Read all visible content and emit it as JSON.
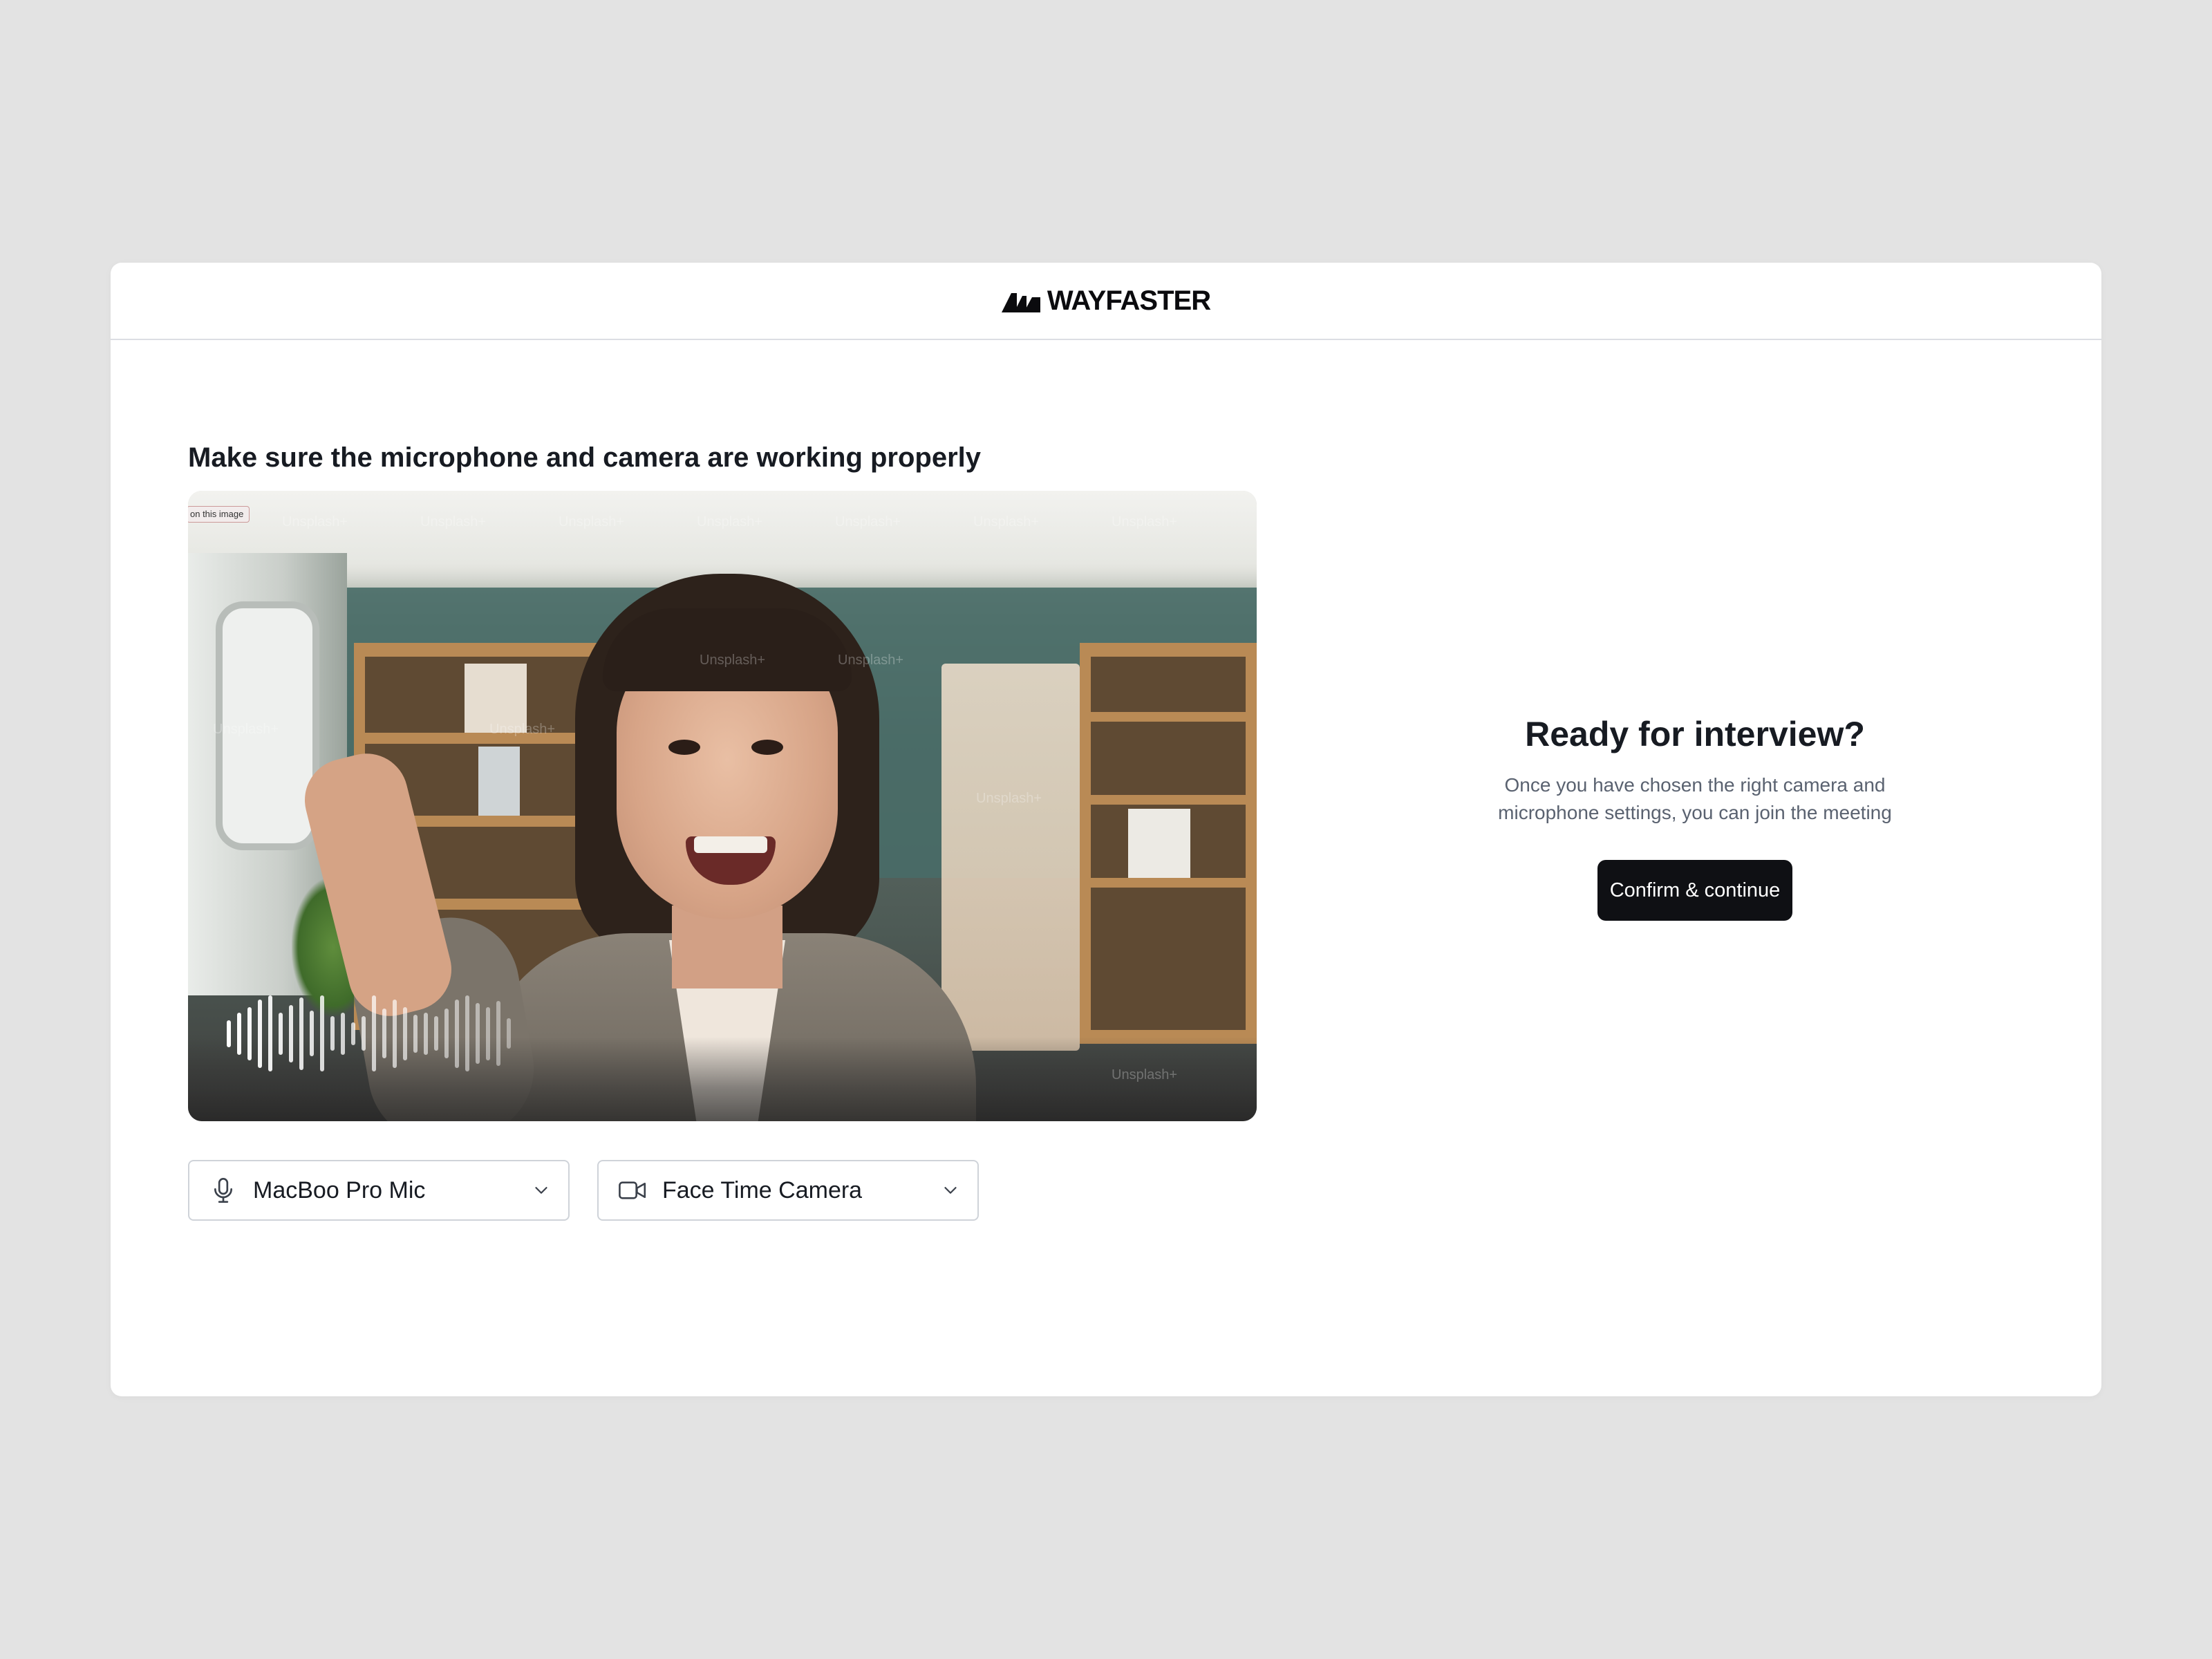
{
  "header": {
    "brand_name": "WAYFASTER",
    "logo_icon": "wayfaster-logo-icon"
  },
  "device_check": {
    "heading": "Make sure the microphone and camera are working properly",
    "video_preview": {
      "photo_tag": "on this image",
      "watermark": "Unsplash+",
      "audio_levels": [
        0.35,
        0.55,
        0.7,
        0.9,
        1.0,
        0.55,
        0.75,
        0.95,
        0.6,
        1.0,
        0.45,
        0.55,
        0.3,
        0.45,
        1.0,
        0.65,
        0.9,
        0.7,
        0.5,
        0.55,
        0.45,
        0.65,
        0.9,
        1.0,
        0.8,
        0.7,
        0.85,
        0.4
      ]
    },
    "microphone": {
      "icon": "microphone-icon",
      "selected": "MacBoo Pro Mic"
    },
    "camera": {
      "icon": "video-camera-icon",
      "selected": "Face Time Camera"
    }
  },
  "ready": {
    "title": "Ready for interview?",
    "description_line1": "Once you have chosen the right camera and",
    "description_line2": "microphone settings, you can join the meeting",
    "confirm_label": "Confirm & continue"
  },
  "colors": {
    "page_bg": "#e3e3e3",
    "card_bg": "#ffffff",
    "primary_button": "#0f1014",
    "muted_text": "#5a6270"
  }
}
